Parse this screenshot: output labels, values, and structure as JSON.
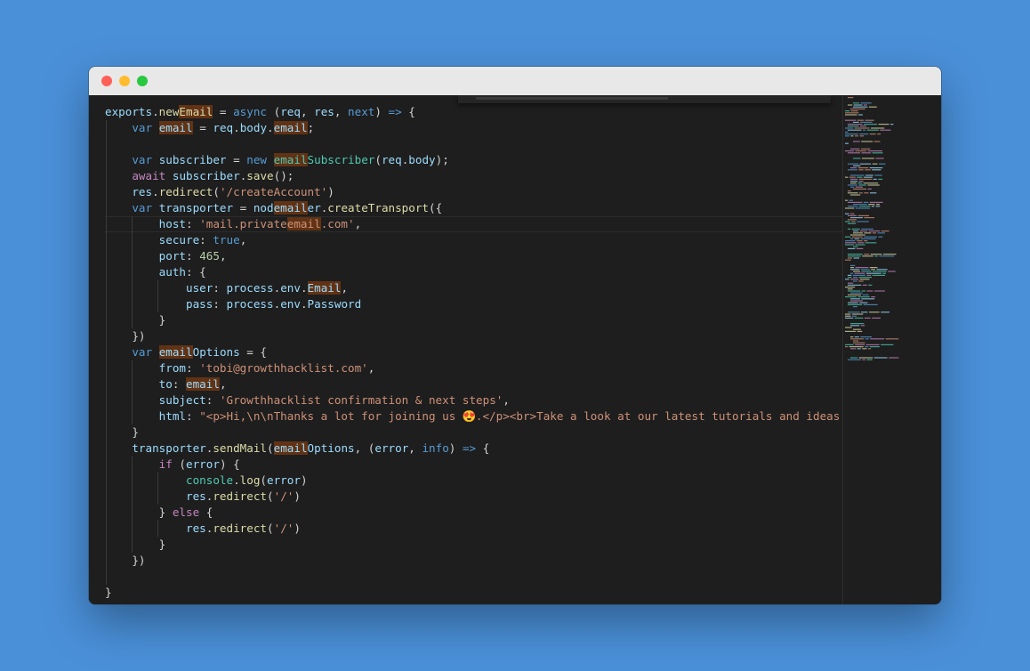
{
  "window": {
    "buttons": [
      "close",
      "minimize",
      "zoom"
    ]
  },
  "colors": {
    "background": "#4a90d9",
    "editor": "#1e1e1e",
    "keyword": "#569cd6",
    "control": "#c586c0",
    "variable": "#9cdcfe",
    "function": "#dcdcaa",
    "class": "#4ec9b0",
    "string": "#ce9178",
    "number": "#b5cea8",
    "highlight": "#613214"
  },
  "code": {
    "lines": [
      {
        "indent": 0,
        "tokens": [
          [
            "v",
            "exports"
          ],
          [
            "p",
            "."
          ],
          [
            "f",
            "new"
          ],
          [
            "f",
            "Email",
            "hl"
          ],
          [
            "p",
            " = "
          ],
          [
            "k",
            "async"
          ],
          [
            "p",
            " ("
          ],
          [
            "v",
            "req"
          ],
          [
            "p",
            ", "
          ],
          [
            "v",
            "res"
          ],
          [
            "p",
            ", "
          ],
          [
            "k",
            "next"
          ],
          [
            "p",
            ") "
          ],
          [
            "k",
            "=>"
          ],
          [
            "p",
            " {"
          ]
        ]
      },
      {
        "indent": 1,
        "tokens": [
          [
            "k",
            "var"
          ],
          [
            "p",
            " "
          ],
          [
            "v",
            "email",
            "hl"
          ],
          [
            "p",
            " = "
          ],
          [
            "v",
            "req"
          ],
          [
            "p",
            "."
          ],
          [
            "v",
            "body"
          ],
          [
            "p",
            "."
          ],
          [
            "v",
            "email",
            "hl"
          ],
          [
            "p",
            ";"
          ]
        ]
      },
      {
        "indent": 1,
        "tokens": []
      },
      {
        "indent": 1,
        "tokens": [
          [
            "k",
            "var"
          ],
          [
            "p",
            " "
          ],
          [
            "v",
            "subscriber"
          ],
          [
            "p",
            " = "
          ],
          [
            "k",
            "new"
          ],
          [
            "p",
            " "
          ],
          [
            "c",
            "email",
            "hl"
          ],
          [
            "c",
            "Subscriber"
          ],
          [
            "p",
            "("
          ],
          [
            "v",
            "req"
          ],
          [
            "p",
            "."
          ],
          [
            "v",
            "body"
          ],
          [
            "p",
            ");"
          ]
        ]
      },
      {
        "indent": 1,
        "tokens": [
          [
            "kc",
            "await"
          ],
          [
            "p",
            " "
          ],
          [
            "v",
            "subscriber"
          ],
          [
            "p",
            "."
          ],
          [
            "f",
            "save"
          ],
          [
            "p",
            "();"
          ]
        ]
      },
      {
        "indent": 1,
        "tokens": [
          [
            "v",
            "res"
          ],
          [
            "p",
            "."
          ],
          [
            "f",
            "redirect"
          ],
          [
            "p",
            "("
          ],
          [
            "s",
            "'/createAccount'"
          ],
          [
            "p",
            ")"
          ]
        ]
      },
      {
        "indent": 1,
        "tokens": [
          [
            "k",
            "var"
          ],
          [
            "p",
            " "
          ],
          [
            "v",
            "transporter"
          ],
          [
            "p",
            " = "
          ],
          [
            "v",
            "nod"
          ],
          [
            "v",
            "email",
            "hl"
          ],
          [
            "v",
            "er"
          ],
          [
            "p",
            "."
          ],
          [
            "f",
            "createTransport"
          ],
          [
            "p",
            "({"
          ]
        ]
      },
      {
        "indent": 2,
        "current": true,
        "tokens": [
          [
            "v",
            "host"
          ],
          [
            "p",
            ": "
          ],
          [
            "s",
            "'mail.private"
          ],
          [
            "s",
            "email",
            "hl"
          ],
          [
            "s",
            ".com'"
          ],
          [
            "p",
            ","
          ]
        ]
      },
      {
        "indent": 2,
        "tokens": [
          [
            "v",
            "secure"
          ],
          [
            "p",
            ": "
          ],
          [
            "k",
            "true"
          ],
          [
            "p",
            ","
          ]
        ]
      },
      {
        "indent": 2,
        "tokens": [
          [
            "v",
            "port"
          ],
          [
            "p",
            ": "
          ],
          [
            "n",
            "465"
          ],
          [
            "p",
            ","
          ]
        ]
      },
      {
        "indent": 2,
        "tokens": [
          [
            "v",
            "auth"
          ],
          [
            "p",
            ": {"
          ]
        ]
      },
      {
        "indent": 3,
        "tokens": [
          [
            "v",
            "user"
          ],
          [
            "p",
            ": "
          ],
          [
            "v",
            "process"
          ],
          [
            "p",
            "."
          ],
          [
            "v",
            "env"
          ],
          [
            "p",
            "."
          ],
          [
            "v",
            "Email",
            "hl"
          ],
          [
            "p",
            ","
          ]
        ]
      },
      {
        "indent": 3,
        "tokens": [
          [
            "v",
            "pass"
          ],
          [
            "p",
            ": "
          ],
          [
            "v",
            "process"
          ],
          [
            "p",
            "."
          ],
          [
            "v",
            "env"
          ],
          [
            "p",
            "."
          ],
          [
            "v",
            "Password"
          ]
        ]
      },
      {
        "indent": 2,
        "tokens": [
          [
            "p",
            "}"
          ]
        ]
      },
      {
        "indent": 1,
        "tokens": [
          [
            "p",
            "})"
          ]
        ]
      },
      {
        "indent": 1,
        "tokens": [
          [
            "k",
            "var"
          ],
          [
            "p",
            " "
          ],
          [
            "v",
            "email",
            "hl"
          ],
          [
            "v",
            "Options"
          ],
          [
            "p",
            " = {"
          ]
        ]
      },
      {
        "indent": 2,
        "tokens": [
          [
            "v",
            "from"
          ],
          [
            "p",
            ": "
          ],
          [
            "s",
            "'tobi@growthhacklist.com'"
          ],
          [
            "p",
            ","
          ]
        ]
      },
      {
        "indent": 2,
        "tokens": [
          [
            "v",
            "to"
          ],
          [
            "p",
            ": "
          ],
          [
            "v",
            "email",
            "hl"
          ],
          [
            "p",
            ","
          ]
        ]
      },
      {
        "indent": 2,
        "tokens": [
          [
            "v",
            "subject"
          ],
          [
            "p",
            ": "
          ],
          [
            "s",
            "'Growthhacklist confirmation & next steps'"
          ],
          [
            "p",
            ","
          ]
        ]
      },
      {
        "indent": 2,
        "tokens": [
          [
            "v",
            "html"
          ],
          [
            "p",
            ": "
          ],
          [
            "s",
            "\"<p>Hi,\\n\\nThanks a lot for joining us "
          ],
          [
            "e",
            "😍"
          ],
          [
            "s",
            ".</p><br>Take a look at our latest tutorials and ideas as a"
          ]
        ]
      },
      {
        "indent": 1,
        "tokens": [
          [
            "p",
            "}"
          ]
        ]
      },
      {
        "indent": 1,
        "tokens": [
          [
            "v",
            "transporter"
          ],
          [
            "p",
            "."
          ],
          [
            "f",
            "sendMail"
          ],
          [
            "p",
            "("
          ],
          [
            "v",
            "email",
            "hl"
          ],
          [
            "v",
            "Options"
          ],
          [
            "p",
            ", ("
          ],
          [
            "v",
            "error"
          ],
          [
            "p",
            ", "
          ],
          [
            "k",
            "info"
          ],
          [
            "p",
            ") "
          ],
          [
            "k",
            "=>"
          ],
          [
            "p",
            " {"
          ]
        ]
      },
      {
        "indent": 2,
        "tokens": [
          [
            "kc",
            "if"
          ],
          [
            "p",
            " ("
          ],
          [
            "v",
            "error"
          ],
          [
            "p",
            ") {"
          ]
        ]
      },
      {
        "indent": 3,
        "tokens": [
          [
            "c",
            "console"
          ],
          [
            "p",
            "."
          ],
          [
            "f",
            "log"
          ],
          [
            "p",
            "("
          ],
          [
            "v",
            "error"
          ],
          [
            "p",
            ")"
          ]
        ]
      },
      {
        "indent": 3,
        "tokens": [
          [
            "v",
            "res"
          ],
          [
            "p",
            "."
          ],
          [
            "f",
            "redirect"
          ],
          [
            "p",
            "("
          ],
          [
            "s",
            "'/'"
          ],
          [
            "p",
            ")"
          ]
        ]
      },
      {
        "indent": 2,
        "tokens": [
          [
            "p",
            "} "
          ],
          [
            "kc",
            "else"
          ],
          [
            "p",
            " {"
          ]
        ]
      },
      {
        "indent": 3,
        "tokens": [
          [
            "v",
            "res"
          ],
          [
            "p",
            "."
          ],
          [
            "f",
            "redirect"
          ],
          [
            "p",
            "("
          ],
          [
            "s",
            "'/'"
          ],
          [
            "p",
            ")"
          ]
        ]
      },
      {
        "indent": 2,
        "tokens": [
          [
            "p",
            "}"
          ]
        ]
      },
      {
        "indent": 1,
        "tokens": [
          [
            "p",
            "})"
          ]
        ]
      },
      {
        "indent": 1,
        "tokens": []
      },
      {
        "indent": 0,
        "tokens": [
          [
            "p",
            "}"
          ]
        ]
      }
    ]
  }
}
